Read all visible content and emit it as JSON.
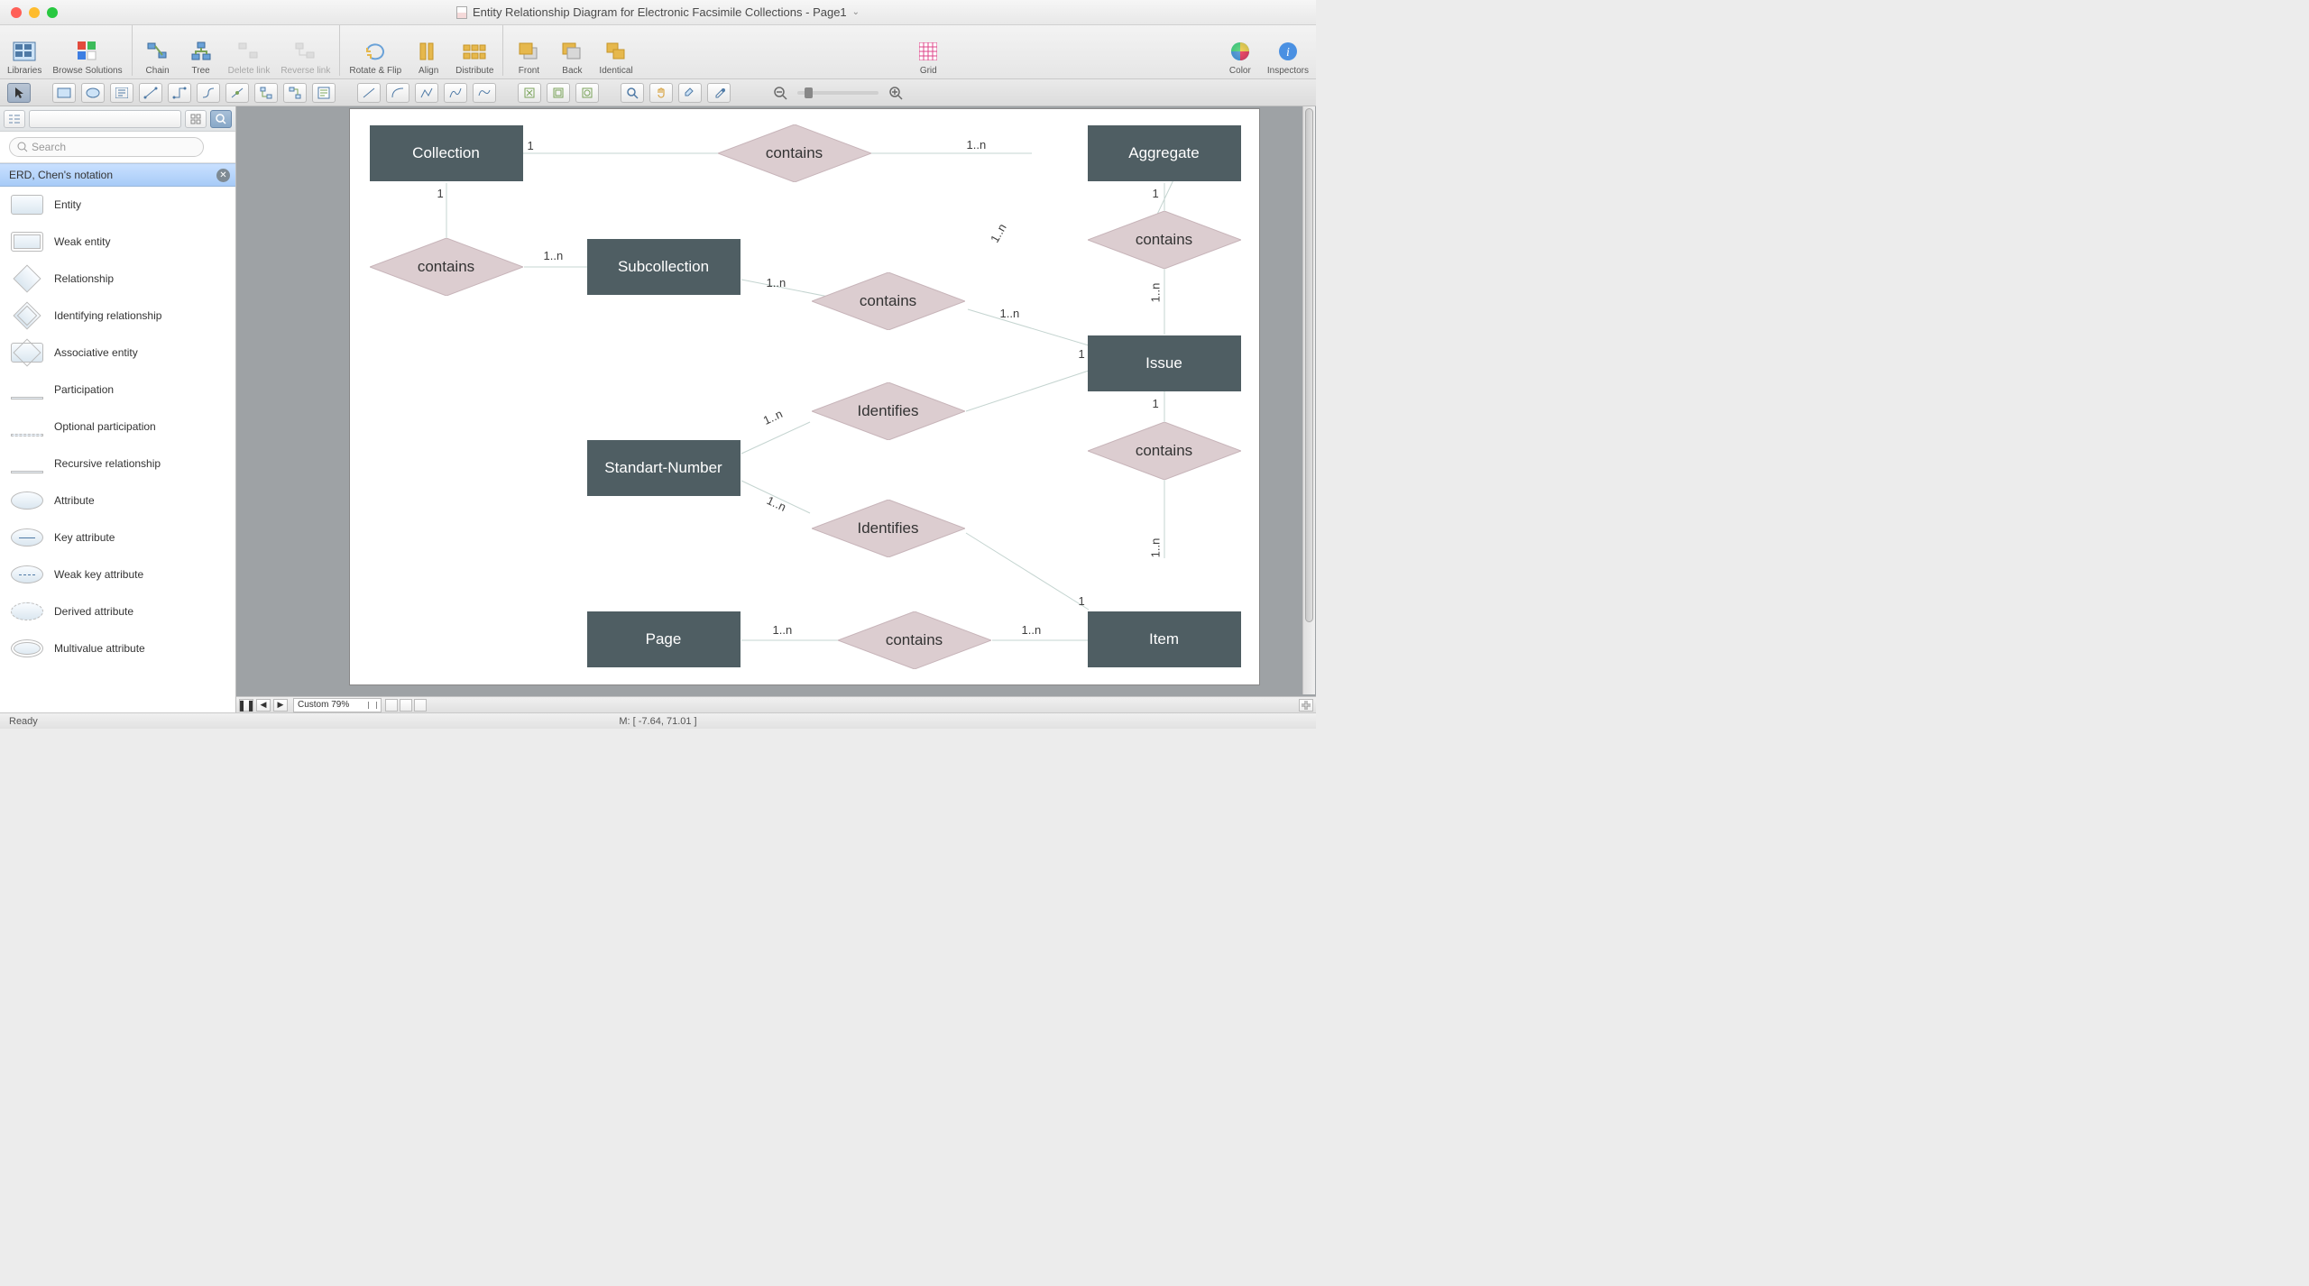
{
  "title": "Entity Relationship Diagram for Electronic Facsimile Collections - Page1",
  "toolbar": {
    "libraries": "Libraries",
    "browse": "Browse Solutions",
    "chain": "Chain",
    "tree": "Tree",
    "delete_link": "Delete link",
    "reverse_link": "Reverse link",
    "rotate_flip": "Rotate & Flip",
    "align": "Align",
    "distribute": "Distribute",
    "front": "Front",
    "back": "Back",
    "identical": "Identical",
    "grid": "Grid",
    "color": "Color",
    "inspectors": "Inspectors"
  },
  "sidebar": {
    "search_placeholder": "Search",
    "section_title": "ERD, Chen's notation",
    "items": [
      "Entity",
      "Weak entity",
      "Relationship",
      "Identifying relationship",
      "Associative entity",
      "Participation",
      "Optional participation",
      "Recursive relationship",
      "Attribute",
      "Key attribute",
      "Weak key attribute",
      "Derived attribute",
      "Multivalue attribute"
    ]
  },
  "zoom_label": "Custom 79%",
  "status": {
    "ready": "Ready",
    "coords": "M: [ -7.64, 71.01 ]"
  },
  "diagram": {
    "entities": {
      "collection": "Collection",
      "aggregate": "Aggregate",
      "subcollection": "Subcollection",
      "issue": "Issue",
      "standart_number": "Standart-Number",
      "page": "Page",
      "item": "Item"
    },
    "relationships": {
      "contains": "contains",
      "identifies": "Identifies"
    },
    "cards": {
      "c1": "1",
      "c1n": "1..n"
    }
  }
}
